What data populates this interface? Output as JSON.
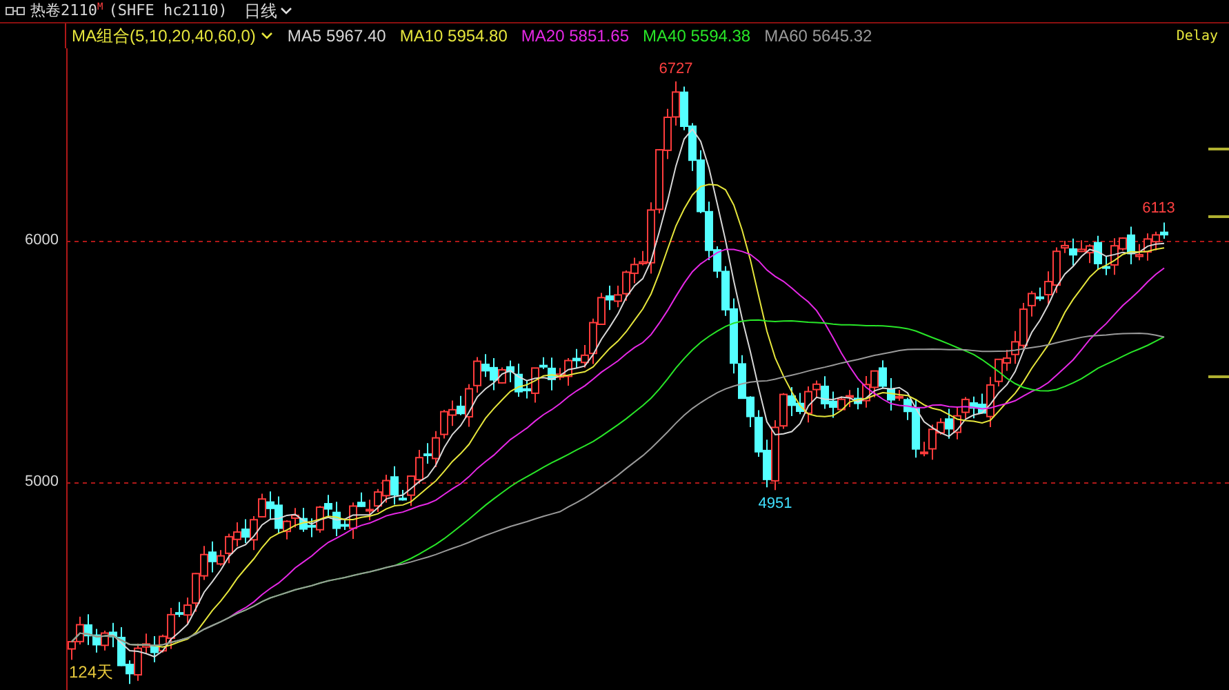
{
  "header": {
    "symbol": "热卷2110",
    "symbol_mark": "M",
    "code": "(SHFE hc2110)",
    "period": "日线"
  },
  "indicator_bar": {
    "preset": "MA组合(5,10,20,40,60,0)",
    "averages": [
      {
        "label": "MA5",
        "value": "5967.40",
        "color": "#d8d8d8"
      },
      {
        "label": "MA10",
        "value": "5954.80",
        "color": "#e6e63c"
      },
      {
        "label": "MA20",
        "value": "5851.65",
        "color": "#e628e6"
      },
      {
        "label": "MA40",
        "value": "5594.38",
        "color": "#28e628"
      },
      {
        "label": "MA60",
        "value": "5645.32",
        "color": "#9a9a9a"
      }
    ],
    "status": "Delay"
  },
  "chart": {
    "y_axis_labels": [
      "6000",
      "5000"
    ],
    "annotations": [
      {
        "text": "6727",
        "kind": "high"
      },
      {
        "text": "4951",
        "kind": "low"
      },
      {
        "text": "6113",
        "kind": "last"
      }
    ],
    "range_label": "124天"
  }
}
